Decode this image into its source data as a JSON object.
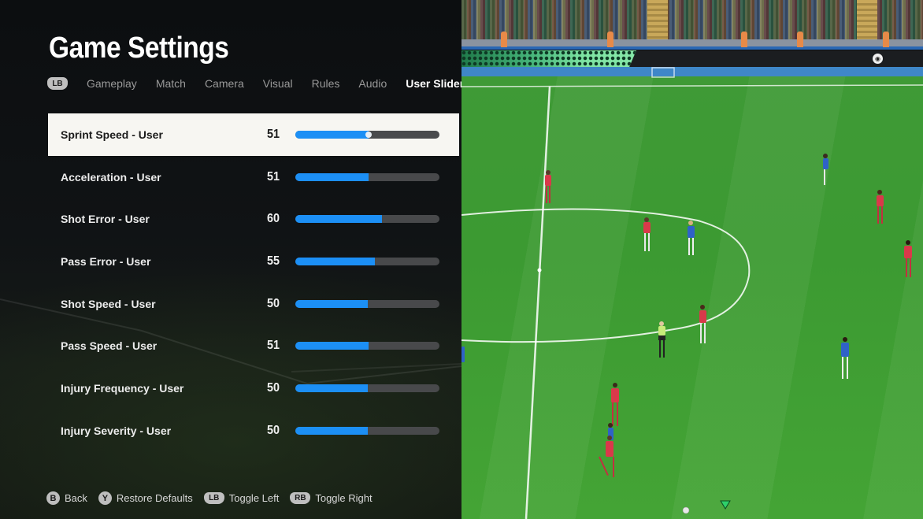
{
  "page": {
    "title": "Game Settings"
  },
  "tabs": {
    "shoulder_left": "LB",
    "items": [
      {
        "label": "Gameplay",
        "active": false
      },
      {
        "label": "Match",
        "active": false
      },
      {
        "label": "Camera",
        "active": false
      },
      {
        "label": "Visual",
        "active": false
      },
      {
        "label": "Rules",
        "active": false
      },
      {
        "label": "Audio",
        "active": false
      },
      {
        "label": "User Sliders",
        "active": true
      }
    ]
  },
  "sliders": {
    "min": 0,
    "max": 100,
    "selected_index": 0,
    "accent_color": "#1c8ff5",
    "items": [
      {
        "label": "Sprint Speed - User",
        "value": 51
      },
      {
        "label": "Acceleration - User",
        "value": 51
      },
      {
        "label": "Shot Error - User",
        "value": 60
      },
      {
        "label": "Pass Error - User",
        "value": 55
      },
      {
        "label": "Shot Speed - User",
        "value": 50
      },
      {
        "label": "Pass Speed - User",
        "value": 51
      },
      {
        "label": "Injury Frequency - User",
        "value": 50
      },
      {
        "label": "Injury Severity - User",
        "value": 50
      }
    ]
  },
  "footer": {
    "hints": [
      {
        "button": "B",
        "shape": "round",
        "label": "Back"
      },
      {
        "button": "Y",
        "shape": "round",
        "label": "Restore Defaults"
      },
      {
        "button": "LB",
        "shape": "bumper",
        "label": "Toggle Left"
      },
      {
        "button": "RB",
        "shape": "bumper",
        "label": "Toggle Right"
      }
    ]
  },
  "game_view": {
    "description": "live match preview",
    "home_kit_color": "#d9394a",
    "away_kit_color": "#2f62c8",
    "referee_kit_color": "#c8ec7a",
    "pitch_color": "#3f9a36"
  }
}
